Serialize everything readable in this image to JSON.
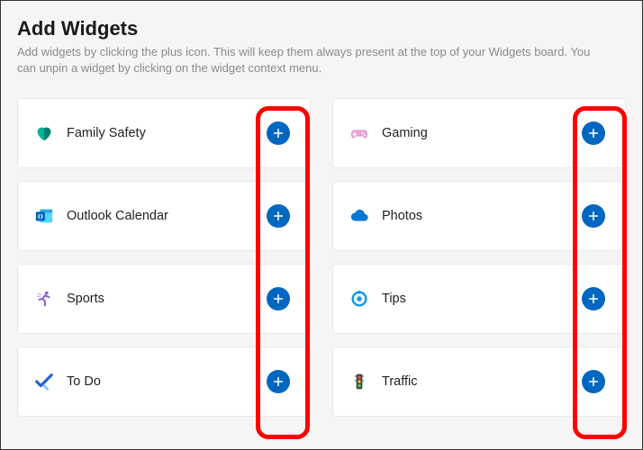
{
  "header": {
    "title": "Add Widgets",
    "subtitle": "Add widgets by clicking the plus icon. This will keep them always present at the top of your Widgets board. You can unpin a widget by clicking on the widget context menu."
  },
  "widgets": [
    {
      "label": "Family Safety",
      "icon": "heart-shield"
    },
    {
      "label": "Gaming",
      "icon": "gamepad"
    },
    {
      "label": "Outlook Calendar",
      "icon": "calendar"
    },
    {
      "label": "Photos",
      "icon": "cloud"
    },
    {
      "label": "Sports",
      "icon": "runner"
    },
    {
      "label": "Tips",
      "icon": "tips"
    },
    {
      "label": "To Do",
      "icon": "check"
    },
    {
      "label": "Traffic",
      "icon": "traffic-light"
    }
  ]
}
